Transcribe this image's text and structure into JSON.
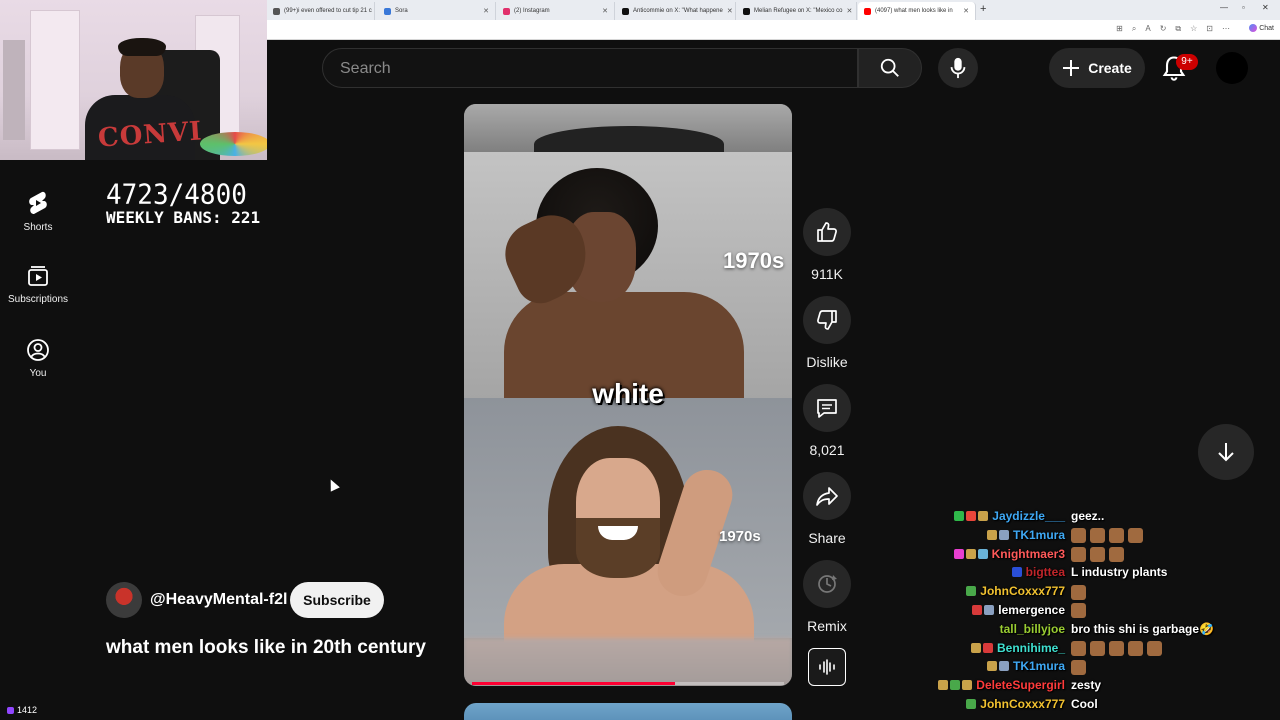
{
  "browser": {
    "tabs": [
      {
        "label": "(99+)i even offered to cut tip 21 c",
        "fav_color": "#555555"
      },
      {
        "label": "Sora",
        "fav_color": "#3a78d8"
      },
      {
        "label": "(2) Instagram",
        "fav_color": "#e1306c"
      },
      {
        "label": "Anticommie on X: \"What happene",
        "fav_color": "#111111"
      },
      {
        "label": "Melian Refugee on X: \"Mexico co",
        "fav_color": "#111111"
      },
      {
        "label": "(4097) what men looks like in",
        "fav_color": "#ff0000"
      }
    ],
    "new_tab": "+",
    "chat_label": "Chat"
  },
  "header": {
    "search_placeholder": "Search",
    "create_label": "Create",
    "notification_badge": "9+"
  },
  "sidebar": {
    "items": [
      {
        "label": "Shorts",
        "icon": "shorts-icon"
      },
      {
        "label": "Subscriptions",
        "icon": "subscriptions-icon"
      },
      {
        "label": "You",
        "icon": "you-icon"
      }
    ]
  },
  "overlay": {
    "ban_count": "4723/4800",
    "weekly_bans": "WEEKLY BANS: 221",
    "viewer_count": "1412"
  },
  "video": {
    "label_top": "1970s",
    "caption": "white",
    "label_bottom": "1970s",
    "progress_percent": 65
  },
  "actions": {
    "like_count": "911K",
    "dislike_label": "Dislike",
    "comment_count": "8,021",
    "share_label": "Share",
    "remix_label": "Remix"
  },
  "channel": {
    "handle": "@HeavyMental-f2l",
    "subscribe_label": "Subscribe",
    "video_title": "what men looks like in 20th century"
  },
  "chat": [
    {
      "user": "Jaydizzle___",
      "color": "#3fa9f5",
      "badges": [
        "#2fb84a",
        "#e8463a",
        "#c9a24a"
      ],
      "msg": "geez..",
      "emotes": 0
    },
    {
      "user": "TK1mura",
      "color": "#3fa9f5",
      "badges": [
        "#c9a24a",
        "#8aa0c0"
      ],
      "msg": "",
      "emotes": 4
    },
    {
      "user": "Knightmaer3",
      "color": "#ff5a5a",
      "badges": [
        "#e83fd0",
        "#c9a24a",
        "#6ab3d8"
      ],
      "msg": "",
      "emotes": 3
    },
    {
      "user": "bigttea",
      "color": "#c0252a",
      "badges": [
        "#2a4fd8"
      ],
      "msg": "L industry plants",
      "emotes": 0
    },
    {
      "user": "JohnCoxxx777",
      "color": "#f2c230",
      "badges": [
        "#49a84a"
      ],
      "msg": "",
      "emotes": 1
    },
    {
      "user": "lemergence",
      "color": "#ffffff",
      "badges": [
        "#d83a3a",
        "#8aa0c0"
      ],
      "msg": "",
      "emotes": 1
    },
    {
      "user": "tall_billyjoe",
      "color": "#9acd32",
      "badges": [],
      "msg": "bro this shi is garbage🤣",
      "emotes": 0
    },
    {
      "user": "Bennihime_",
      "color": "#3fe0d0",
      "badges": [
        "#c9a24a",
        "#d83a3a"
      ],
      "msg": "",
      "emotes": 5
    },
    {
      "user": "TK1mura",
      "color": "#3fa9f5",
      "badges": [
        "#c9a24a",
        "#8aa0c0"
      ],
      "msg": "",
      "emotes": 1
    },
    {
      "user": "DeleteSupergirl",
      "color": "#ff3b3b",
      "badges": [
        "#c9a24a",
        "#49a84a",
        "#c9a24a"
      ],
      "msg": "zesty",
      "emotes": 0
    },
    {
      "user": "JohnCoxxx777",
      "color": "#f2c230",
      "badges": [
        "#49a84a"
      ],
      "msg": "Cool",
      "emotes": 0
    }
  ]
}
